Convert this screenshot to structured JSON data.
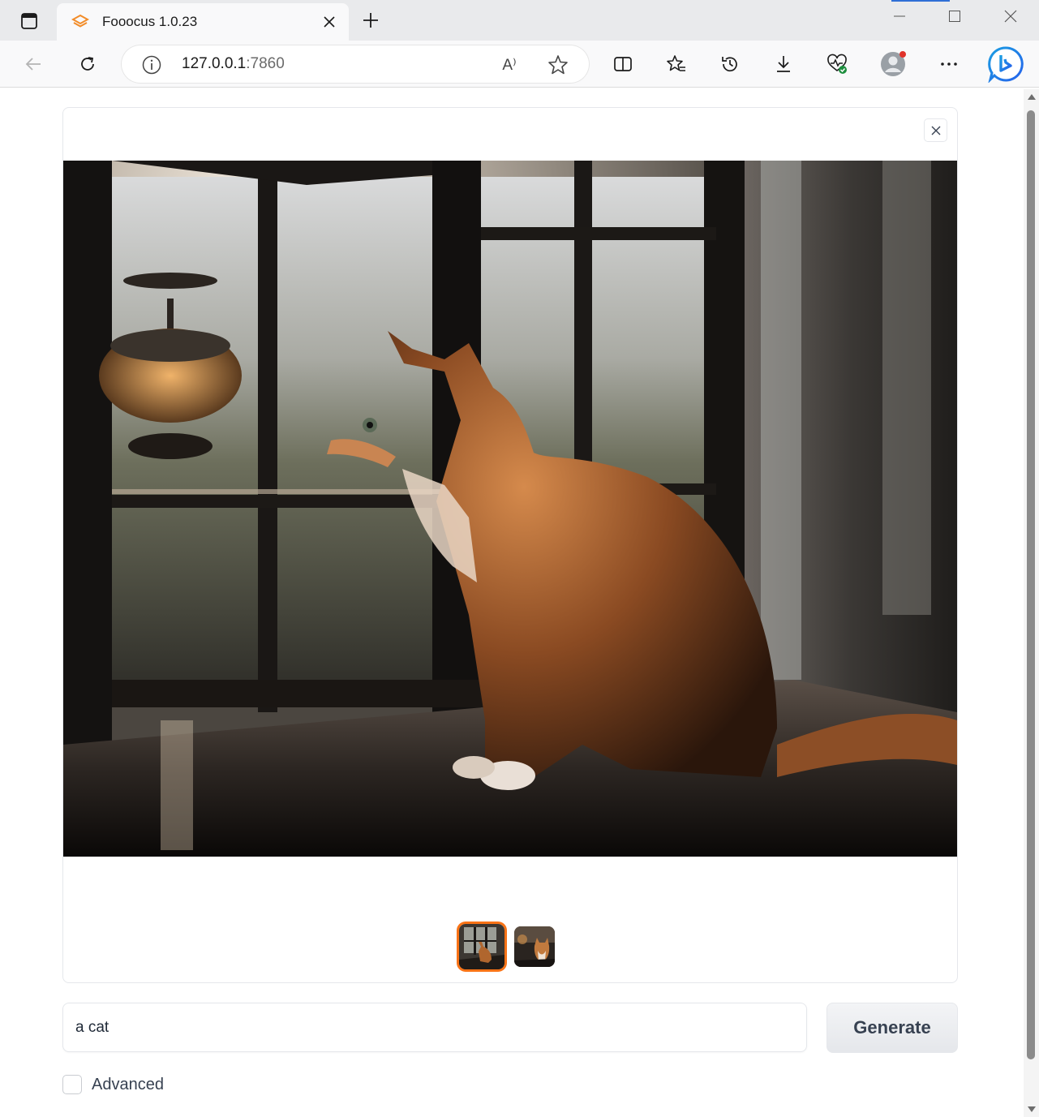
{
  "browser": {
    "tab_title": "Fooocus 1.0.23",
    "url_host": "127.0.0.1",
    "url_port": ":7860",
    "read_aloud_glyph": "A⁾"
  },
  "gallery": {
    "image_count": 2,
    "selected_index": 0
  },
  "prompt": {
    "value": "a cat"
  },
  "generate_label": "Generate",
  "advanced": {
    "label": "Advanced",
    "checked": false
  },
  "colors": {
    "accent": "#f97316",
    "browser_accent": "#2f6fd6"
  }
}
